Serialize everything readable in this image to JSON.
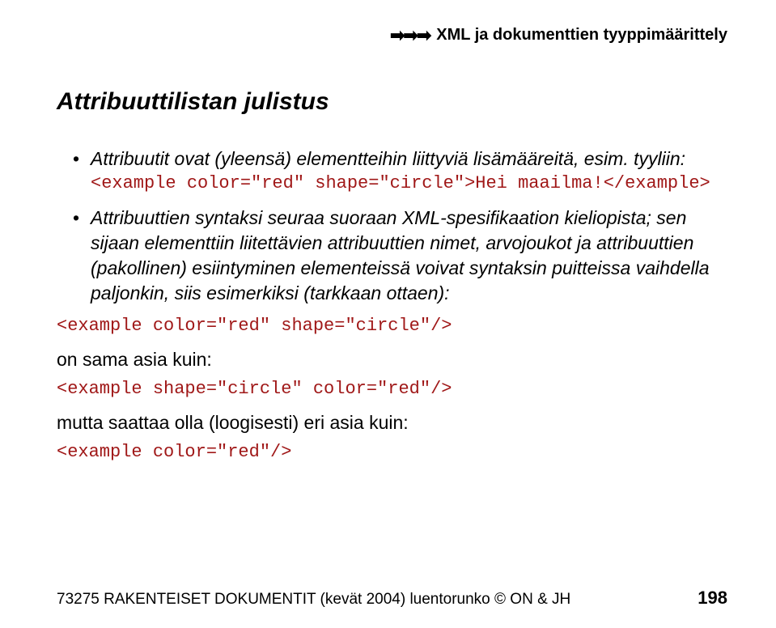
{
  "header": {
    "arrows": "➡➡➡",
    "text": "XML ja dokumenttien tyyppimäärittely"
  },
  "title": "Attribuuttilistan julistus",
  "bullets": [
    {
      "text": "Attribuutit ovat (yleensä) elementteihin liittyviä lisämääreitä, esim. tyyliin:",
      "code": "<example color=\"red\" shape=\"circle\">Hei maailma!</example>"
    },
    {
      "text": "Attribuuttien syntaksi seuraa suoraan XML-spesifikaation kieliopista; sen sijaan elementtiin liitettävien attribuuttien nimet, arvojoukot ja attribuuttien (pakollinen) esiintyminen elementeissä voivat syntaksin puitteissa vaihdella paljonkin, siis esimerkiksi (tarkkaan ottaen):"
    }
  ],
  "codeExamples": {
    "ex1": "<example color=\"red\" shape=\"circle\"/>",
    "label1": "on sama asia kuin:",
    "ex2": "<example shape=\"circle\" color=\"red\"/>",
    "label2": "mutta saattaa olla (loogisesti) eri asia kuin:",
    "ex3": "<example color=\"red\"/>"
  },
  "footer": {
    "left": "73275 RAKENTEISET DOKUMENTIT (kevät 2004) luentorunko © ON & JH",
    "pageNumber": "198"
  }
}
